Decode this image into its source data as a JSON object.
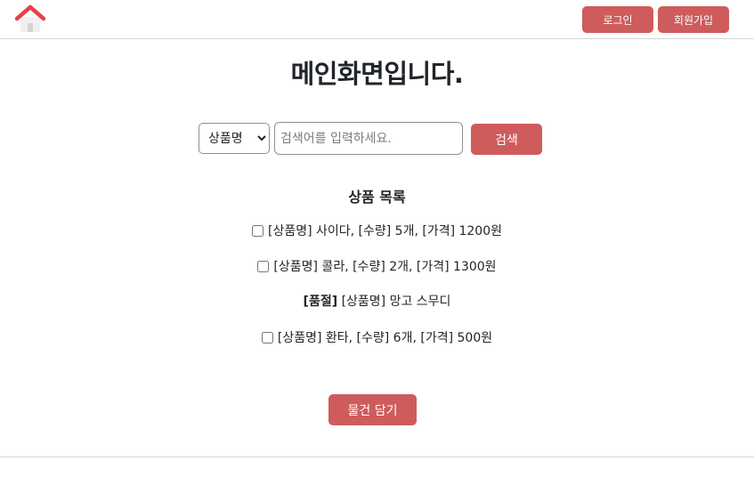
{
  "header": {
    "home_icon": "home-icon",
    "login_label": "로그인",
    "signup_label": "회원가입"
  },
  "main": {
    "title": "메인화면입니다."
  },
  "search": {
    "select_value": "상품명",
    "placeholder": "검색어를 입력하세요.",
    "input_value": "",
    "button_label": "검색"
  },
  "products": {
    "title": "상품 목록",
    "items": [
      {
        "text": "[상품명] 사이다, [수량] 5개, [가격] 1200원",
        "checked": false
      },
      {
        "text": "[상품명] 콜라, [수량] 2개, [가격] 1300원",
        "checked": false
      },
      {
        "tag": "[품절]",
        "text": "[상품명] 망고 스무디"
      },
      {
        "text": "[상품명] 환타, [수량] 6개, [가격] 500원",
        "checked": false
      }
    ]
  },
  "cart": {
    "button_label": "물건 담기"
  },
  "colors": {
    "accent": "#cf5c5c",
    "home_roof": "#e8414a",
    "divider": "#d6d6d6"
  }
}
